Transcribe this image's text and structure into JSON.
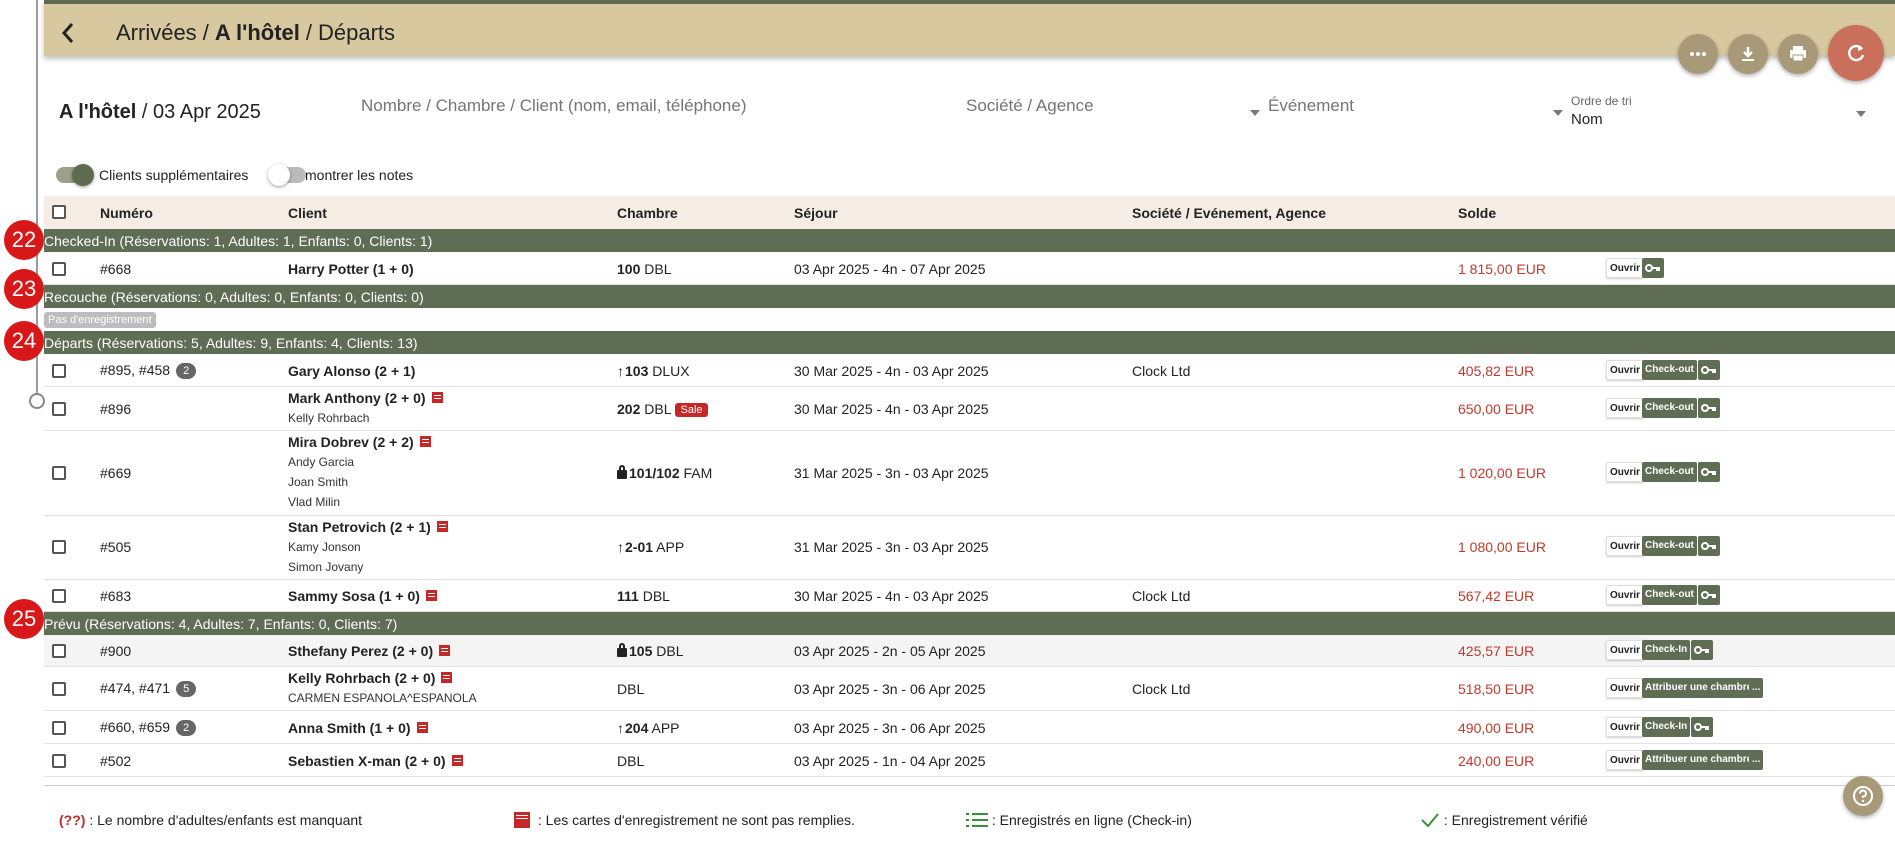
{
  "header": {
    "breadcrumb": [
      "Arrivées",
      "A l'hôtel",
      "Départs"
    ],
    "sep": "/"
  },
  "toolbar": {
    "icons": [
      "more-icon",
      "download-icon",
      "print-icon",
      "refresh-icon"
    ]
  },
  "page": {
    "title_prefix": "A l'hôtel",
    "title_sep": "/",
    "title_date": "03 Apr 2025"
  },
  "filters": {
    "search_placeholder": "Nombre / Chambre / Client (nom, email, téléphone)",
    "company_placeholder": "Société / Agence",
    "event_placeholder": "Événement",
    "sort_label": "Ordre de tri",
    "sort_value": "Nom"
  },
  "toggles": {
    "extra_clients": {
      "label": "Clients supplémentaires",
      "on": true
    },
    "show_notes": {
      "label": "montrer les notes",
      "on": false
    }
  },
  "columns": [
    "Numéro",
    "Client",
    "Chambre",
    "Séjour",
    "Société / Evénement, Agence",
    "Solde"
  ],
  "groups": {
    "checked_in": {
      "marker": "22",
      "label": "Checked-In (Réservations: 1, Adultes: 1, Enfants: 0, Clients: 1)"
    },
    "recouche": {
      "marker": "23",
      "label": "Recouche (Réservations: 0, Adultes: 0, Enfants: 0, Clients: 0)",
      "empty_badge": "Pas d'enregistrement"
    },
    "departs": {
      "marker": "24",
      "label": "Départs (Réservations: 5, Adultes: 9, Enfants: 4, Clients: 13)"
    },
    "prevu": {
      "marker": "25",
      "label": "Prévu (Réservations: 4, Adultes: 7, Enfants: 0, Clients: 7)"
    }
  },
  "rows": [
    {
      "number": "#668",
      "client": "Harry Potter (1 + 0)",
      "room_num": "100",
      "room_type": "DBL",
      "stay": "03 Apr 2025 - 4n - 07 Apr 2025",
      "company": "",
      "balance": "1 815,00 EUR",
      "open": "Ouvrir"
    },
    {
      "number": "#895, #458",
      "count": "2",
      "client": "Gary Alonso (2 + 1)",
      "room_num": "103",
      "room_type": "DLUX",
      "stay": "30 Mar 2025 - 4n - 03 Apr 2025",
      "company": "Clock Ltd",
      "balance": "405,82 EUR",
      "open": "Ouvrir",
      "action": "Check-out"
    },
    {
      "number": "#896",
      "client": "Mark Anthony (2 + 0)",
      "subs": [
        "Kelly Rohrbach"
      ],
      "room_num": "202",
      "room_type": "DBL",
      "sale": "Sale",
      "stay": "30 Mar 2025 - 4n - 03 Apr 2025",
      "company": "",
      "balance": "650,00 EUR",
      "open": "Ouvrir",
      "action": "Check-out"
    },
    {
      "number": "#669",
      "client": "Mira Dobrev (2 + 2)",
      "subs": [
        "Andy Garcia",
        "Joan Smith",
        "Vlad Milin"
      ],
      "room_num": "101/102",
      "room_type": "FAM",
      "stay": "31 Mar 2025 - 3n - 03 Apr 2025",
      "company": "",
      "balance": "1 020,00 EUR",
      "open": "Ouvrir",
      "action": "Check-out"
    },
    {
      "number": "#505",
      "client": "Stan Petrovich (2 + 1)",
      "subs": [
        "Kamy Jonson",
        "Simon Jovany"
      ],
      "room_num": "2-01",
      "room_type": "APP",
      "stay": "31 Mar 2025 - 3n - 03 Apr 2025",
      "company": "",
      "balance": "1 080,00 EUR",
      "open": "Ouvrir",
      "action": "Check-out"
    },
    {
      "number": "#683",
      "client": "Sammy Sosa (1 + 0)",
      "room_num": "111",
      "room_type": "DBL",
      "stay": "30 Mar 2025 - 4n - 03 Apr 2025",
      "company": "Clock Ltd",
      "balance": "567,42 EUR",
      "open": "Ouvrir",
      "action": "Check-out"
    },
    {
      "number": "#900",
      "client": "Sthefany Perez (2 + 0)",
      "room_num": "105",
      "room_type": "DBL",
      "stay": "03 Apr 2025 - 2n - 05 Apr 2025",
      "company": "",
      "balance": "425,57 EUR",
      "open": "Ouvrir",
      "action": "Check-In"
    },
    {
      "number": "#474, #471",
      "count": "5",
      "client": "Kelly Rohrbach (2 + 0)",
      "subs": [
        "CARMEN ESPANOLA^ESPANOLA"
      ],
      "room_num": "",
      "room_type": "DBL",
      "stay": "03 Apr 2025 - 3n - 06 Apr 2025",
      "company": "Clock Ltd",
      "balance": "518,50 EUR",
      "open": "Ouvrir",
      "action": "Attribuer une chambre",
      "more": "..."
    },
    {
      "number": "#660, #659",
      "count": "2",
      "client": "Anna Smith (1 + 0)",
      "room_num": "204",
      "room_type": "APP",
      "stay": "03 Apr 2025 - 3n - 06 Apr 2025",
      "company": "",
      "balance": "490,00 EUR",
      "open": "Ouvrir",
      "action": "Check-In"
    },
    {
      "number": "#502",
      "client": "Sebastien X-man (2 + 0)",
      "room_num": "",
      "room_type": "DBL",
      "stay": "03 Apr 2025 - 1n - 04 Apr 2025",
      "company": "",
      "balance": "240,00 EUR",
      "open": "Ouvrir",
      "action": "Attribuer une chambre",
      "more": "..."
    }
  ],
  "legend": {
    "missing_mark": "(??)",
    "missing": ": Le nombre d'adultes/enfants est manquant",
    "cards": ": Les cartes d'enregistrement ne sont pas remplies.",
    "online": ": Enregistrés en ligne (Check-in)",
    "verified": ": Enregistrement vérifié"
  },
  "colors": {
    "accent": "#606d55",
    "header": "#d8c8a0",
    "refresh": "#c96f5b",
    "balance": "#c0392b",
    "marker": "#d81818"
  }
}
